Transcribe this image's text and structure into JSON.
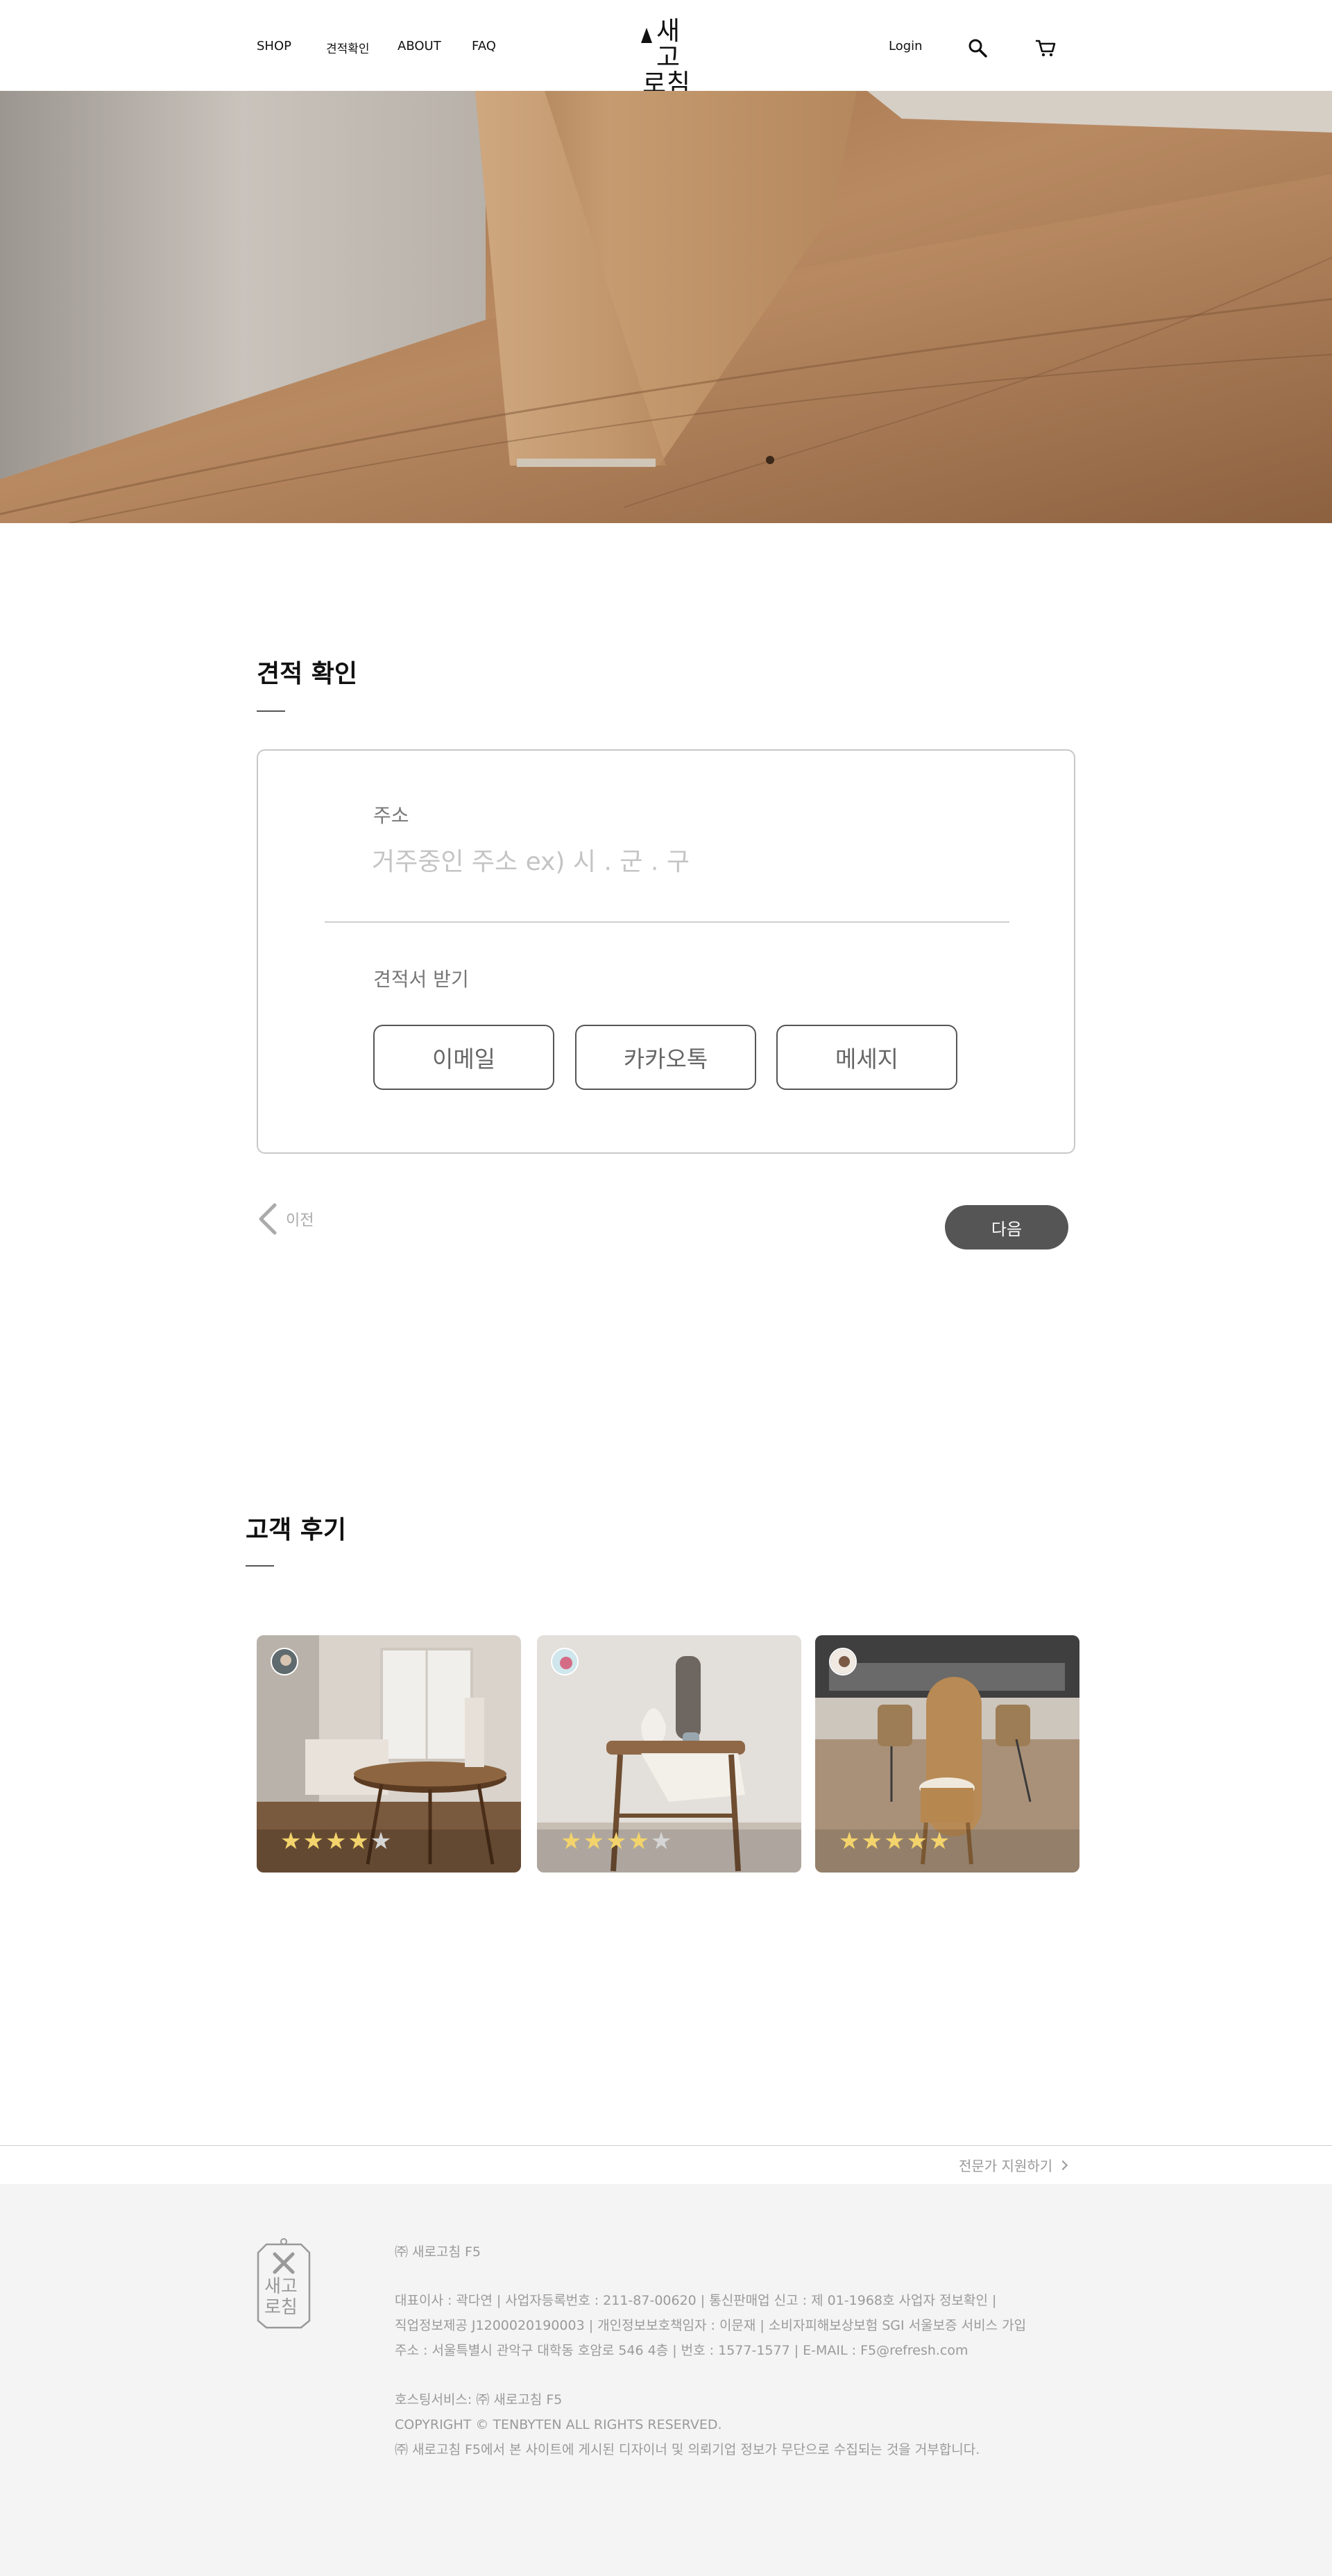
{
  "header": {
    "nav": {
      "shop": "SHOP",
      "quote": "견적확인",
      "about": "ABOUT",
      "faq": "FAQ"
    },
    "logo": {
      "line1": "새고",
      "line2": "로침"
    },
    "login": "Login",
    "icons": {
      "search": "search-icon",
      "cart": "cart-icon"
    }
  },
  "quote": {
    "title": "견적 확인",
    "address_label": "주소",
    "address_placeholder": "거주중인 주소 ex) 시 . 군 . 구",
    "address_value": "",
    "receive_label": "견적서 받기",
    "options": [
      "이메일",
      "카카오톡",
      "메세지"
    ],
    "prev_label": "이전",
    "next_label": "다음"
  },
  "reviews": {
    "title": "고객 후기",
    "items": [
      {
        "rating": 4,
        "max": 5
      },
      {
        "rating": 4,
        "max": 5
      },
      {
        "rating": 5,
        "max": 5
      }
    ]
  },
  "footer": {
    "expert_link": "전문가 지원하기",
    "logo_line1": "새고",
    "logo_line2": "로침",
    "company": "㈜ 새로고침 F5",
    "line1": "대표이사 : 곽다연 | 사업자등록번호 : 211-87-00620 | 통신판매업 신고 : 제 01-1968호 사업자 정보확인 |",
    "line2": "직업정보제공 J1200020190003 | 개인정보보호책임자 : 이문재 | 소비자피해보상보험 SGI 서울보증 서비스 가입",
    "line3": "주소 : 서울특별시 관악구 대학동 호암로 546 4층 | 번호 : 1577-1577 | E-MAIL : F5@refresh.com",
    "hosting": "호스팅서비스: ㈜ 새로고침 F5",
    "copyright": "COPYRIGHT © TENBYTEN ALL RIGHTS RESERVED.",
    "notice": "㈜ 새로고침 F5에서 본 사이트에 게시된 디자이너 및 의뢰기업 정보가 무단으로 수집되는 것을 거부합니다."
  },
  "colors": {
    "next_button": "#555555",
    "star_filled": "#f3d36b",
    "star_empty": "#d5d5d5",
    "footer_bg": "#f4f4f4"
  }
}
